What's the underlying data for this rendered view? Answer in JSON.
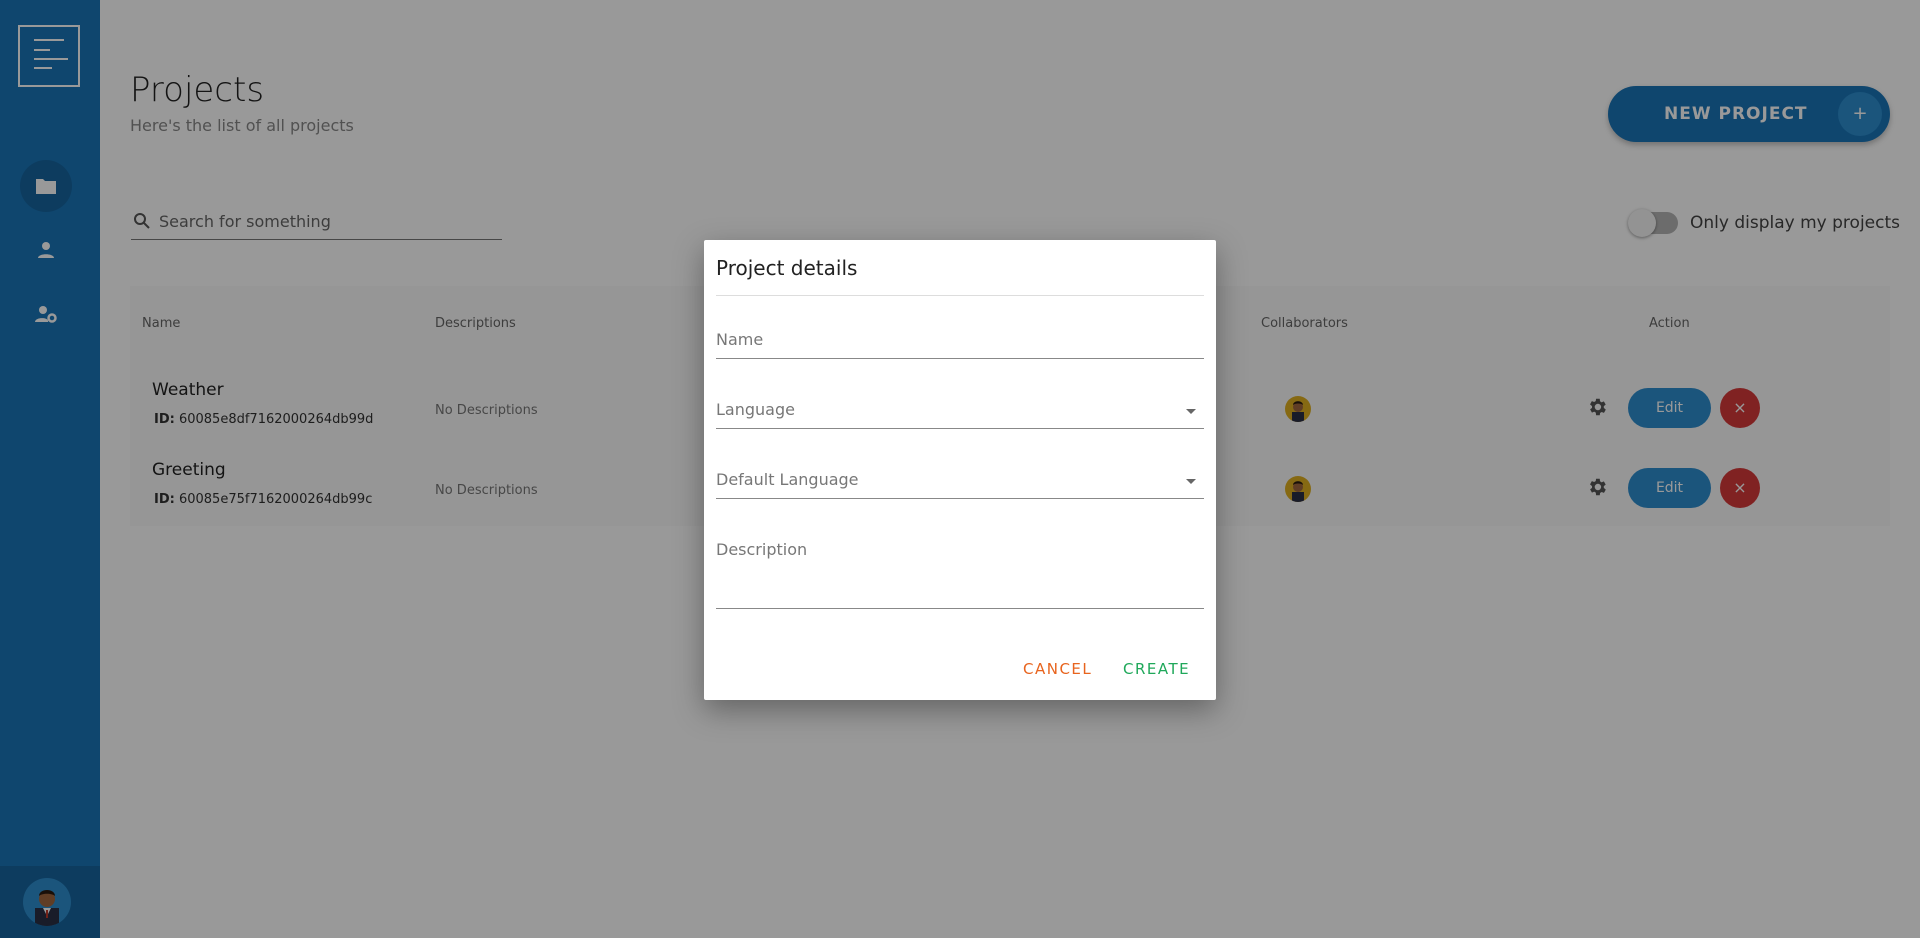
{
  "page": {
    "title": "Projects",
    "subtitle": "Here's the list of all projects",
    "new_project_label": "NEW PROJECT",
    "new_project_icon": "+"
  },
  "search": {
    "placeholder": "Search for something"
  },
  "filter": {
    "toggle_label": "Only display my projects",
    "toggle_on": false
  },
  "table": {
    "headers": [
      "Name",
      "Descriptions",
      "Collaborators",
      "Action"
    ],
    "rows": [
      {
        "name": "Weather",
        "id_label": "ID:",
        "id": "60085e8df7162000264db99d",
        "description": "No Descriptions",
        "edit_label": "Edit",
        "delete_icon": "×"
      },
      {
        "name": "Greeting",
        "id_label": "ID:",
        "id": "60085e75f7162000264db99c",
        "description": "No Descriptions",
        "edit_label": "Edit",
        "delete_icon": "×"
      }
    ]
  },
  "dialog": {
    "title": "Project details",
    "name_label": "Name",
    "language_label": "Language",
    "default_language_label": "Default Language",
    "description_label": "Description",
    "cancel_label": "CANCEL",
    "create_label": "CREATE"
  },
  "colors": {
    "sidebar": "#1a75b8",
    "primary": "#2d8ecf",
    "danger": "#d63a3a",
    "cancel": "#e8641e",
    "create": "#1fa85a"
  },
  "icons": [
    "menu-logo-icon",
    "folder-icon",
    "user-icon",
    "user-settings-icon",
    "search-icon",
    "gear-icon",
    "close-icon",
    "caret-down-icon",
    "avatar-icon"
  ]
}
